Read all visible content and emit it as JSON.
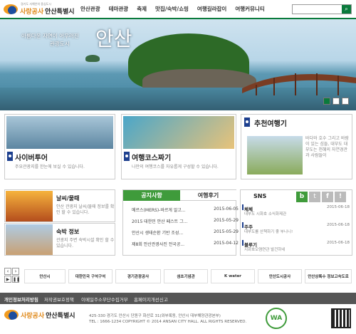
{
  "header": {
    "logo_sub": "경기도 서해안의 중심도시",
    "logo_main_1": "사랑공사",
    "logo_main_2": "안산특별시"
  },
  "nav": [
    "안산관광",
    "테마관광",
    "축제",
    "맛집/숙박/쇼핑",
    "여행길라잡이",
    "여행커뮤니티"
  ],
  "search": {
    "placeholder": ""
  },
  "hero": {
    "slogan_line1": "아름다운 자연이 어우러진",
    "slogan_line2": "관광도시",
    "big_text": "안산"
  },
  "cards": {
    "cyber": {
      "title": "사이버투어",
      "desc": "주요관광지를 한눈에 보실 수 있습니다."
    },
    "course": {
      "title": "여행코스짜기",
      "desc": "나만의 여행코스를 자유롭게 구성할 수 있습니다."
    },
    "recommend": {
      "title": "추천여행기",
      "desc": "바다와 호수 그리고 바람이 있는 섬들, 대부도 대부도는 천혜의 자연경관과 사람들이"
    }
  },
  "weather": {
    "title": "날씨/물때",
    "desc": "안산 관광지 날씨/물때 정보를 확인 할 수 있습니다."
  },
  "lodging": {
    "title": "숙박 정보",
    "desc": "관광지 주변 숙박시설 확인 할 수 있습니다."
  },
  "tabs": {
    "notice": "공지사항",
    "travelog": "여행후기"
  },
  "notices": [
    {
      "title": "메르스(MERS)-바르게 알고...",
      "date": "2015-06-05"
    },
    {
      "title": "2015 대한민 안산 페스트 그...",
      "date": "2015-05-29"
    },
    {
      "title": "안산시 생태순환 기반 조성...",
      "date": "2015-05-29"
    },
    {
      "title": "제8회 안산관광사진 전국공...",
      "date": "2015-04-12"
    }
  ],
  "sns": {
    "title": "SNS",
    "items": [
      {
        "head": "체체",
        "date": "2015-06-18",
        "content": "대부도 시화호 소식화제관"
      },
      {
        "head": "주주",
        "date": "2015-06-18",
        "content": "대부도를 산책하기 좋 부니니!"
      },
      {
        "head": "블루기",
        "date": "2015-06-18",
        "content": "시화호오염연관 발건하네"
      }
    ]
  },
  "banners": [
    "안산시",
    "대한민국 구석구석",
    "경기관광공사",
    "섬초기념관",
    "K water",
    "안산도시공사",
    "안산상록수 정보고속도로"
  ],
  "footer_nav": [
    "개인정보처리방침",
    "저작권보호정책",
    "이메일주소무단수집거부",
    "홈페이지개선신고"
  ],
  "footer": {
    "address": "425-330 경기도 안산시 단원구 화산로 31(와부록동, 안산시 대부해양관광본부)",
    "phone": "TEL : 1666-1234 COPYRIGHT © 2014 ANSAN CITY HALL. ALL RIGHTS RESERVED.",
    "wa": "WA"
  },
  "colors": {
    "accent": "#0a7a3c",
    "navy": "#1d3f8e"
  }
}
